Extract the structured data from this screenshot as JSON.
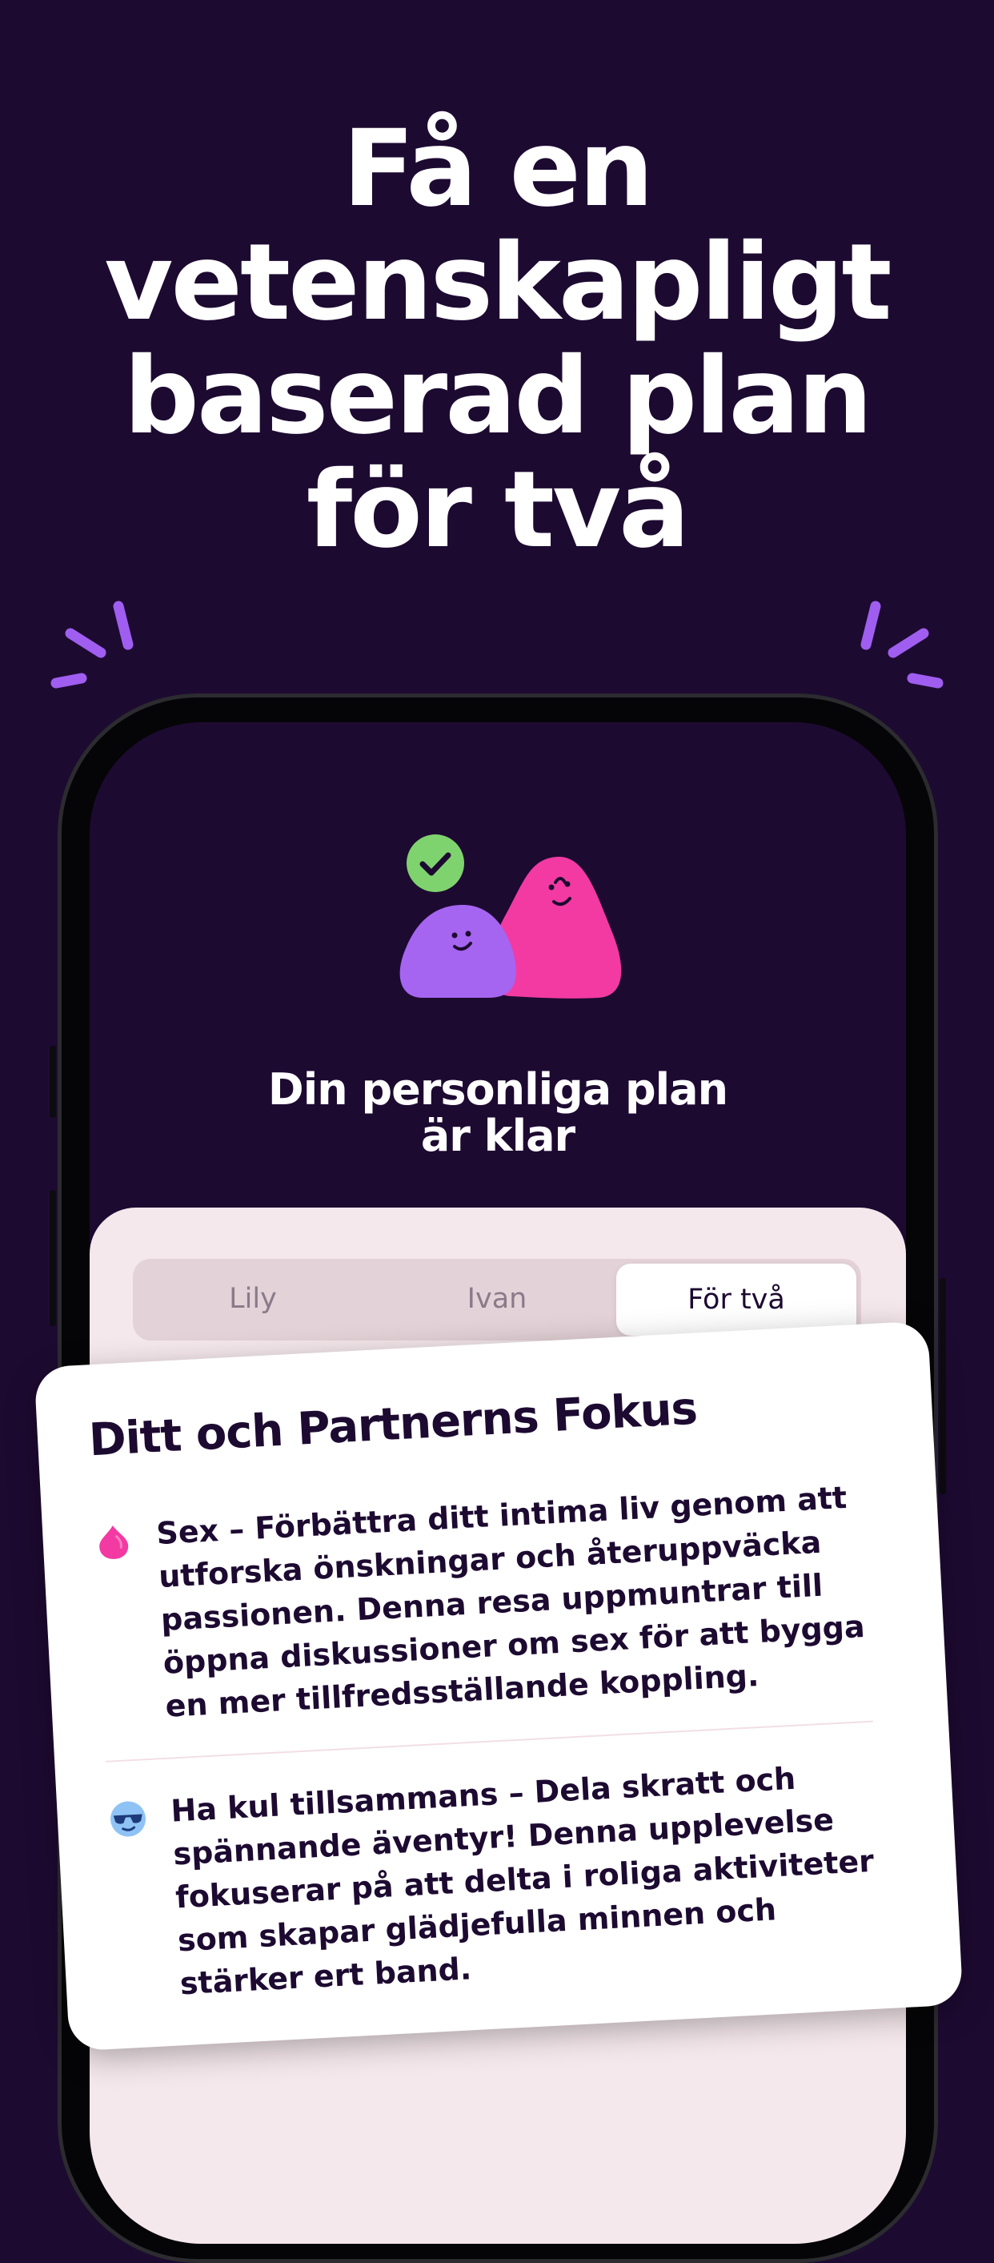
{
  "headline": [
    "Få en",
    "vetenskapligt",
    "baserad plan",
    "för två"
  ],
  "plan_title": [
    "Din personliga plan",
    "är klar"
  ],
  "tabs": [
    {
      "label": "Lily",
      "active": false
    },
    {
      "label": "Ivan",
      "active": false
    },
    {
      "label": "För två",
      "active": true
    }
  ],
  "card": {
    "title": "Ditt och Partnerns Fokus",
    "items": [
      {
        "icon": "pink-drop-icon",
        "lines": [
          "Sex – Förbättra ditt intima liv genom att",
          "utforska önskningar och återuppväcka",
          "passionen. Denna resa uppmuntrar till",
          "öppna diskussioner om sex för att bygga",
          "en mer tillfredsställande koppling."
        ]
      },
      {
        "icon": "sunglasses-face-icon",
        "lines": [
          "Ha kul tillsammans – Dela skratt och",
          "spännande äventyr! Denna upplevelse",
          "fokuserar på att delta i roliga aktiviteter",
          "som skapar glädjefulla minnen och",
          "stärker ert band."
        ]
      }
    ]
  },
  "colors": {
    "background": "#1d0a31",
    "accent_purple": "#9f5ef0",
    "check_green": "#7fd36e",
    "blob_pink": "#f23aa2",
    "blob_purple": "#a565f0",
    "sheet": "#f5e8ec",
    "text_dark": "#1d0a31"
  }
}
